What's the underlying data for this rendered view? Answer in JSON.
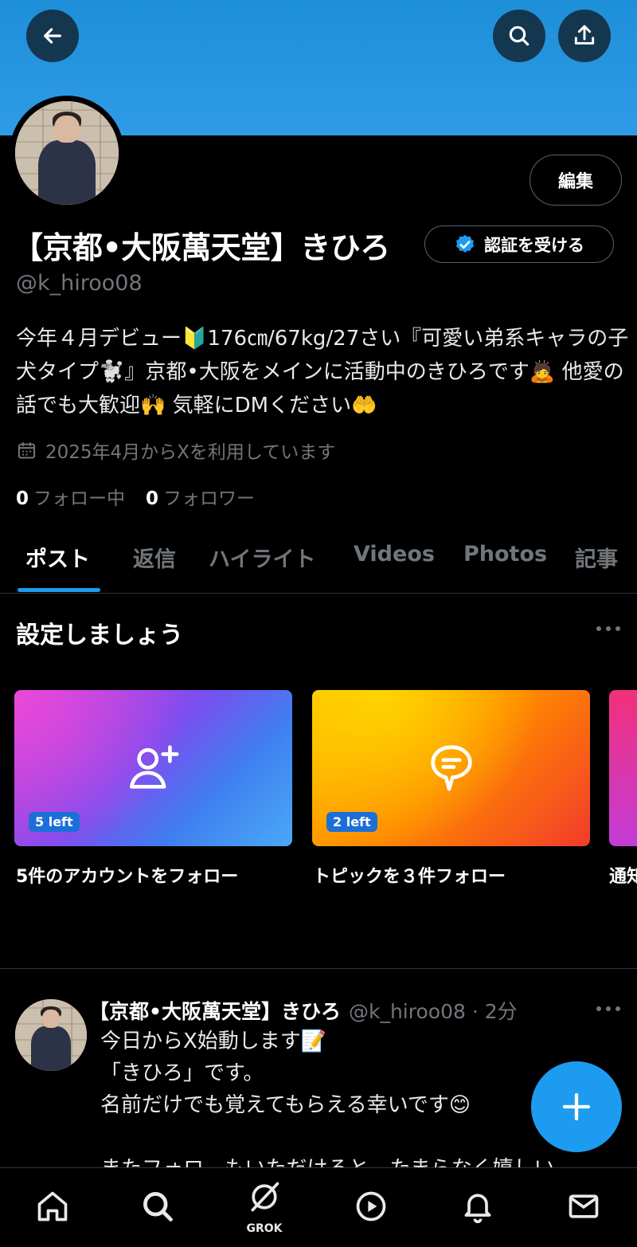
{
  "header": {
    "back_icon": "arrow-left-icon",
    "search_icon": "search-icon",
    "share_icon": "share-icon"
  },
  "profile": {
    "edit_label": "編集",
    "name": "【京都•大阪萬天堂】きひろ",
    "verify_label": "認証を受ける",
    "handle": "@k_hiroo08",
    "bio": "今年４月デビュー🔰176㎝/67kg/27さい『可愛い弟系キャラの子犬タイプ🐩』京都•大阪をメインに活動中のきひろです🙇 他愛の話でも大歓迎🙌 気軽にDMください🤲",
    "joined": "2025年4月からXを利用しています",
    "following_count": "0",
    "following_label": "フォロー中",
    "followers_count": "0",
    "followers_label": "フォロワー"
  },
  "tabs": [
    "ポスト",
    "返信",
    "ハイライト",
    "Videos",
    "Photos",
    "記事"
  ],
  "setup": {
    "title": "設定しましょう",
    "cards": [
      {
        "badge": "5 left",
        "label": "5件のアカウントをフォロー",
        "icon": "add-user-icon"
      },
      {
        "badge": "2 left",
        "label": "トピックを３件フォロー",
        "icon": "topic-icon"
      },
      {
        "label": "通知"
      }
    ]
  },
  "post": {
    "author": "【京都•大阪萬天堂】きひろ",
    "meta": "@k_hiroo08 · 2分",
    "body": "今日からX始動します📝\n「きひろ」です。\n名前だけでも覚えてもらえる幸いです😊\n\nまたフォロ　もいただけると　たまらなく嬉しい"
  },
  "nav": {
    "items": [
      "home-icon",
      "search-icon",
      "grok-icon",
      "play-icon",
      "bell-icon",
      "mail-icon"
    ],
    "grok_label": "GROK"
  },
  "colors": {
    "accent": "#1d9bf0",
    "banner": "#2f9be6",
    "muted": "#71767b"
  }
}
